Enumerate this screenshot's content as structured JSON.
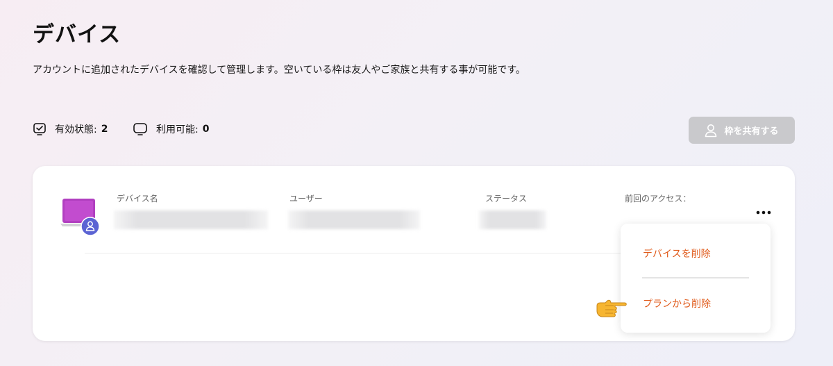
{
  "page": {
    "title": "デバイス",
    "description": "アカウントに追加されたデバイスを確認して管理します。空いている枠は友人やご家族と共有する事が可能です。"
  },
  "stats": {
    "active_label": "有効状態:",
    "active_value": "2",
    "available_label": "利用可能:",
    "available_value": "0"
  },
  "share_button": {
    "label": "枠を共有する"
  },
  "device_table": {
    "columns": [
      "デバイス名",
      "ユーザー",
      "ステータス",
      "前回のアクセス："
    ],
    "rows": [
      {
        "device_name": "",
        "user": "",
        "status": "",
        "last_access": ""
      }
    ]
  },
  "context_menu": {
    "items": [
      "デバイスを削除",
      "プランから削除"
    ]
  },
  "icons": {
    "active": "device-check-icon",
    "available": "monitor-icon",
    "share": "user-icon",
    "device": "laptop-icon",
    "more": "more-dots-icon",
    "pointer": "pointing-hand-icon"
  },
  "colors": {
    "accent": "#e05a1a",
    "share_button_bg": "#c9c9cc",
    "device_screen": "#b13fc0",
    "user_badge": "#5b63d3"
  }
}
